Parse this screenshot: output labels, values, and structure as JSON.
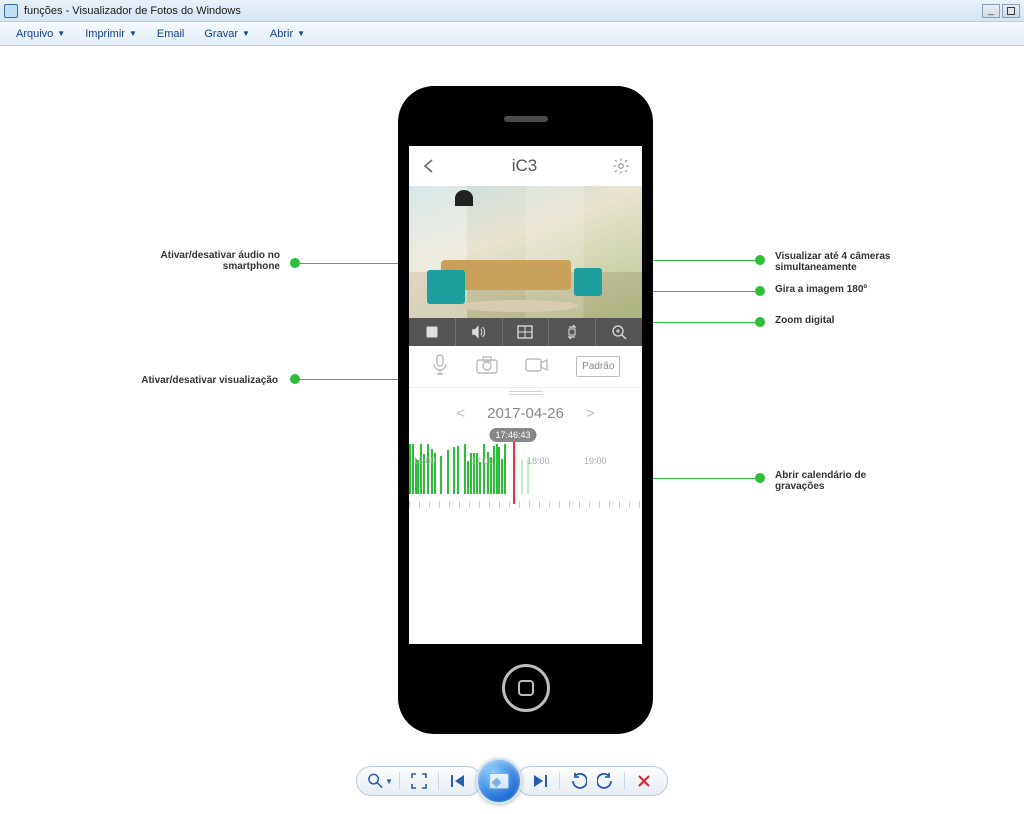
{
  "window": {
    "title": "funções - Visualizador de Fotos do Windows"
  },
  "menus": {
    "arquivo": "Arquivo",
    "imprimir": "Imprimir",
    "email": "Email",
    "gravar": "Gravar",
    "abrir": "Abrir"
  },
  "phone": {
    "title": "iC3",
    "quality_button": "Padrão",
    "date": "2017-04-26",
    "date_prev": "<",
    "date_next": ">",
    "playhead_time": "17:46:43",
    "tick_labels": {
      "1600": "16:00",
      "1700": "17:00",
      "1800": "18:00",
      "1900": "19:00"
    }
  },
  "annotations": {
    "audio": "Ativar/desativar áudio no smartphone",
    "visualizacao": "Ativar/desativar visualização",
    "multiview": "Visualizar até 4 câmeras simultaneamente",
    "rotate": "Gira a imagem 180º",
    "zoom": "Zoom digital",
    "calendar": "Abrir calendário de gravações"
  }
}
